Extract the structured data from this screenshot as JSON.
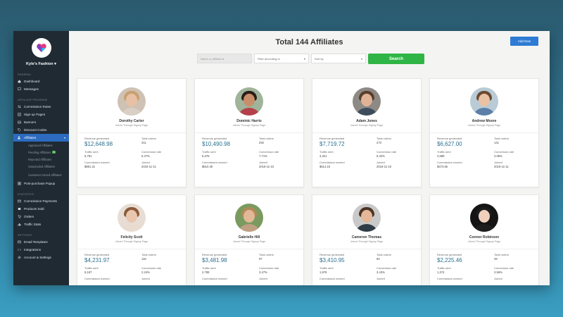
{
  "store": {
    "name": "Kyle's Fashion"
  },
  "sidebar": {
    "sections": [
      {
        "title": "General",
        "items": [
          {
            "label": "Dashboard",
            "icon": "home-icon"
          },
          {
            "label": "Messages",
            "icon": "chat-icon"
          }
        ]
      },
      {
        "title": "Affiliate Program",
        "items": [
          {
            "label": "Commission Rules",
            "icon": "sliders-icon"
          },
          {
            "label": "Sign-up Pages",
            "icon": "form-icon"
          },
          {
            "label": "Banners",
            "icon": "image-icon"
          },
          {
            "label": "Discount Codes",
            "icon": "tag-icon"
          },
          {
            "label": "Affiliates",
            "icon": "users-icon",
            "active": true
          }
        ]
      }
    ],
    "affiliate_sub": [
      {
        "label": "Approved Affiliates"
      },
      {
        "label": "Pending Affiliates",
        "badge": "3"
      },
      {
        "label": "Rejected Affiliates"
      },
      {
        "label": "Suspended Affiliates"
      },
      {
        "label": "Customer turned affiliates"
      }
    ],
    "post_purchase": {
      "label": "Post-purchase Popup",
      "icon": "popup-icon"
    },
    "statistics": {
      "title": "Statistics",
      "items": [
        {
          "label": "Commission Payments",
          "icon": "card-icon"
        },
        {
          "label": "Products Sold",
          "icon": "box-icon"
        },
        {
          "label": "Orders",
          "icon": "cart-icon"
        },
        {
          "label": "Traffic Stats",
          "icon": "chart-icon"
        }
      ]
    },
    "settings": {
      "title": "Settings",
      "items": [
        {
          "label": "Email Templates",
          "icon": "mail-icon"
        },
        {
          "label": "Integrations",
          "icon": "code-icon"
        },
        {
          "label": "Account & Settings",
          "icon": "gear-icon"
        }
      ]
    }
  },
  "header": {
    "title": "Total 144 Affiliates",
    "add_label": "Add New"
  },
  "filters": {
    "search_placeholder": "Name or affiliate id",
    "filter_label": "Filter according to",
    "sort_label": "Sort by",
    "search_button": "Search"
  },
  "labels": {
    "revenue": "Revenue generated",
    "orders": "Total orders",
    "traffic": "Traffic sent",
    "conversion": "Conversion rate",
    "commission": "Commission earned",
    "joined": "Joined"
  },
  "affiliates": [
    {
      "name": "Dorothy Carter",
      "source": "Joined Through Signup Page",
      "revenue": "$12,648.98",
      "orders": "311",
      "traffic": "6,781",
      "conversion": "5.47%",
      "commission": "$881.31",
      "joined": "2018-11-11",
      "skin": "#e8c1a5",
      "hair": "#c8a070",
      "shirt": "#d9cfc4",
      "bg": "#cfc2b4"
    },
    {
      "name": "Dominic Harris",
      "source": "Joined Through Signup Page",
      "revenue": "$10,490.98",
      "orders": "292",
      "traffic": "5,376",
      "conversion": "7.71%",
      "commission": "$610.49",
      "joined": "2018-11-10",
      "skin": "#c98e6a",
      "hair": "#2b1d16",
      "shirt": "#b5404a",
      "bg": "#9fb49a"
    },
    {
      "name": "Adam Jones",
      "source": "Joined Through Signup Page",
      "revenue": "$7,719.72",
      "orders": "273",
      "traffic": "4,321",
      "conversion": "6.32%",
      "commission": "$514.15",
      "joined": "2018-11-10",
      "skin": "#e1b396",
      "hair": "#5a3d2a",
      "shirt": "#3d4d5c",
      "bg": "#8d8a86"
    },
    {
      "name": "Andrew Moore",
      "source": "Joined Through Signup Page",
      "revenue": "$6,627.00",
      "orders": "141",
      "traffic": "4,589",
      "conversion": "3.08%",
      "commission": "$473.55",
      "joined": "2018-11-11",
      "skin": "#e9c2a4",
      "hair": "#6b4a30",
      "shirt": "#5c7fa8",
      "bg": "#b8cbd6"
    },
    {
      "name": "Felicity Scott",
      "source": "Joined Through Signup Page",
      "revenue": "$4,231.97",
      "orders": "116",
      "traffic": "5,187",
      "conversion": "2.24%",
      "commission": "",
      "joined": "",
      "skin": "#e9c6ae",
      "hair": "#8a5a3a",
      "shirt": "#e8dcd0",
      "bg": "#e7ddd4"
    },
    {
      "name": "Gabrielle Hill",
      "source": "Joined Through Signup Page",
      "revenue": "$3,481.98",
      "orders": "97",
      "traffic": "2,789",
      "conversion": "3.47%",
      "commission": "",
      "joined": "",
      "skin": "#e3b899",
      "hair": "#b08a56",
      "shirt": "#c0a082",
      "bg": "#7a9a60"
    },
    {
      "name": "Cameron Thomas",
      "source": "Joined Through Signup Page",
      "revenue": "$3,410.95",
      "orders": "60",
      "traffic": "1,978",
      "conversion": "3.43%",
      "commission": "",
      "joined": "",
      "skin": "#e4b798",
      "hair": "#4a3324",
      "shirt": "#2f3b45",
      "bg": "#c9c9c9"
    },
    {
      "name": "Connor Robinson",
      "source": "Joined Through Signup Page",
      "revenue": "$2,225.46",
      "orders": "49",
      "traffic": "1,374",
      "conversion": "3.56%",
      "commission": "",
      "joined": "",
      "skin": "#f0d0bc",
      "hair": "#1c1c1c",
      "shirt": "#1e1e1e",
      "bg": "#141414"
    }
  ]
}
